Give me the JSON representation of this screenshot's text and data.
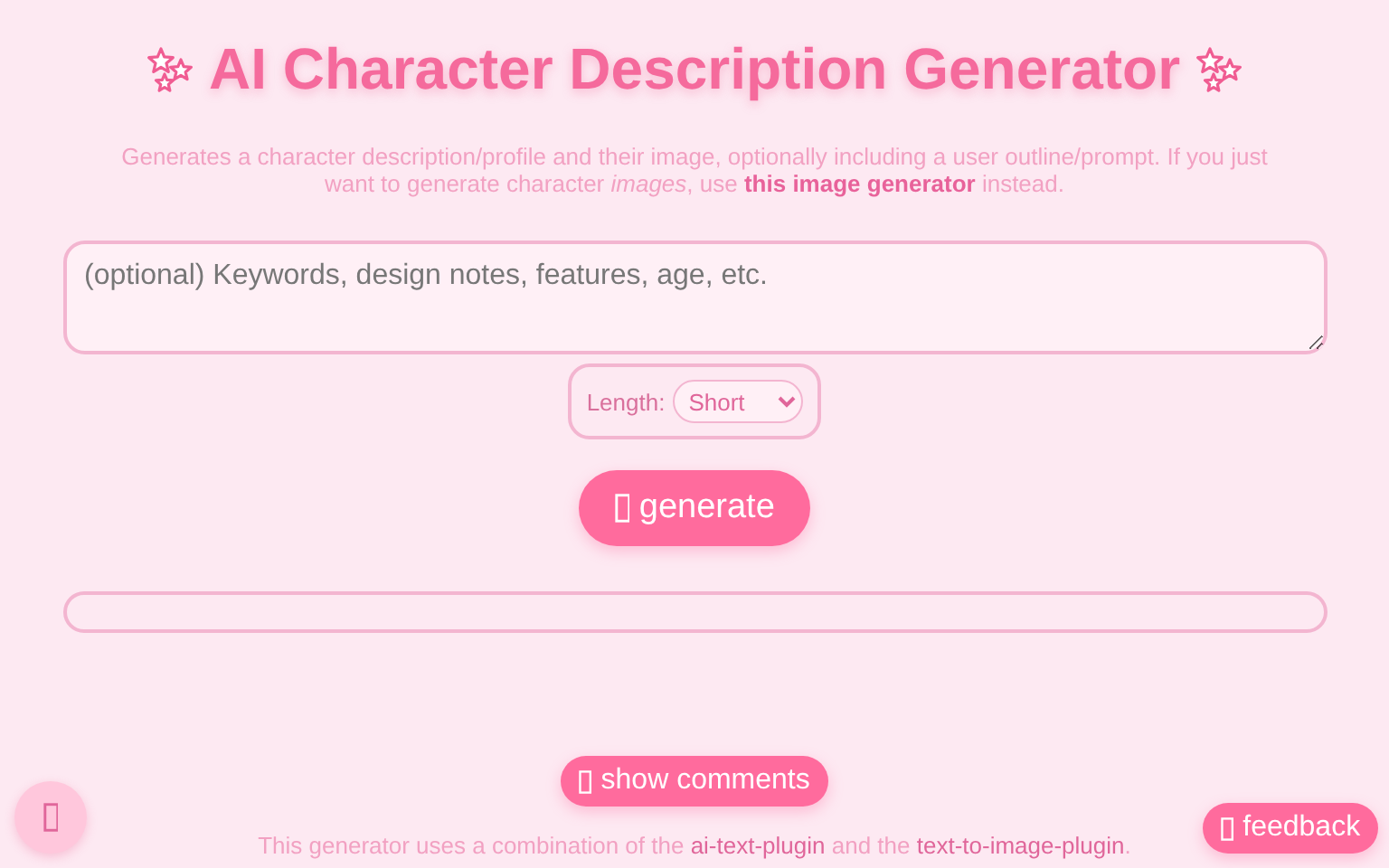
{
  "title": "AI Character Description Generator",
  "description": {
    "before": "Generates a character description/profile and their image, optionally including a user outline/prompt. If you just want to generate character *images*, use ",
    "link": "this image generator",
    "after": " instead."
  },
  "prompt": {
    "placeholder": "(optional) Keywords, design notes, features, age, etc."
  },
  "length": {
    "label": "Length:",
    "value": "Short"
  },
  "generate_button": {
    "label": "generate"
  },
  "comments_button": {
    "label": "show comments"
  },
  "feedback_button": {
    "label": "feedback"
  },
  "footer": {
    "before": "This generator uses a combination of the ",
    "link_1": "ai-text-plugin",
    "middle": " and the ",
    "link_2": "text-to-image-plugin",
    "after": "."
  }
}
